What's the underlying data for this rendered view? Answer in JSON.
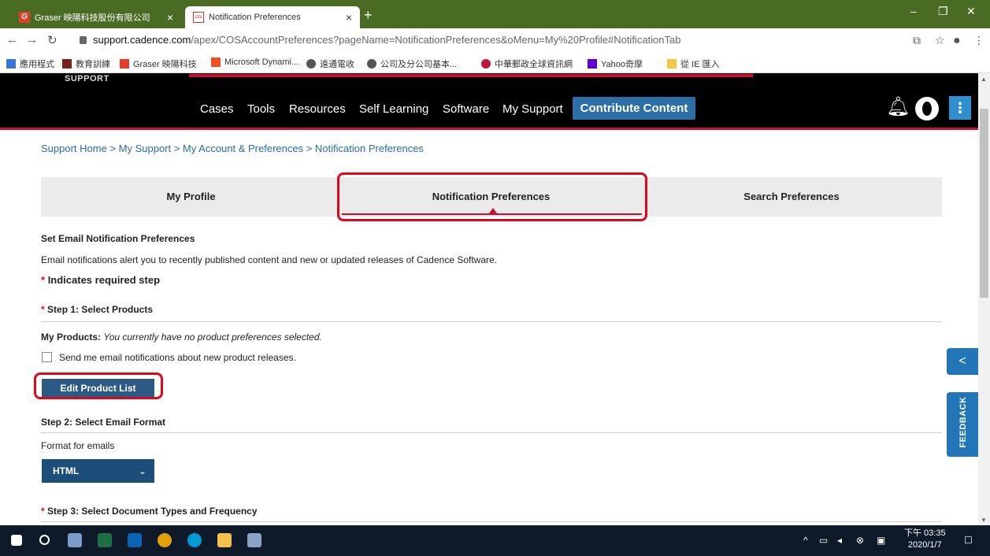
{
  "browser": {
    "tabs": [
      {
        "label": "Graser 映陽科技股份有限公司",
        "active": false
      },
      {
        "label": "Notification Preferences",
        "active": true
      }
    ],
    "url_host": "support.cadence.com",
    "url_path": "/apex/COSAccountPreferences?pageName=NotificationPreferences&oMenu=My%20Profile#NotificationTab",
    "bookmarks": [
      "應用程式",
      "教育訓練",
      "Graser 映陽科技",
      "Microsoft Dynami...",
      "遠通電收",
      "公司及分公司基本...",
      "中華郵政全球資訊網",
      "Yahoo奇摩",
      "從 IE 匯入"
    ]
  },
  "site": {
    "brand_sub": "SUPPORT",
    "nav": [
      "Cases",
      "Tools",
      "Resources",
      "Self Learning",
      "Software",
      "My Support"
    ],
    "contribute": "Contribute Content"
  },
  "breadcrumb": "Support Home > My Support > My Account & Preferences > Notification Preferences",
  "page_tabs": [
    "My Profile",
    "Notification Preferences",
    "Search Preferences"
  ],
  "content": {
    "heading": "Set Email Notification Preferences",
    "description": "Email notifications alert you to recently published content and new or updated releases of Cadence Software.",
    "required_mark": "*",
    "required_note": "Indicates required step",
    "step1": "Step 1: Select Products",
    "my_products_label": "My Products:",
    "my_products_value": "You currently have no product preferences selected.",
    "checkbox_label": "Send me email notifications about new product releases.",
    "edit_button": "Edit Product List",
    "step2": "Step 2: Select Email Format",
    "format_label": "Format for emails",
    "format_value": "HTML",
    "step3": "Step 3: Select Document Types and Frequency"
  },
  "side": {
    "feedback": "FEEDBACK"
  },
  "taskbar": {
    "time": "下午 03:35",
    "date": "2020/1/7"
  },
  "colors": {
    "accent": "#c8102e",
    "link": "#2b6ca3",
    "button": "#2c5a86",
    "highlight": "#e1061b"
  }
}
